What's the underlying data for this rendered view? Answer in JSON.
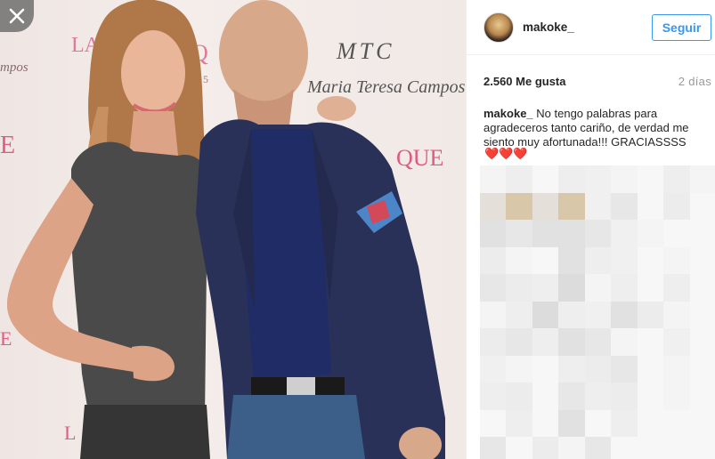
{
  "post": {
    "username": "makoke_",
    "follow_label": "Seguir",
    "likes": "2.560 Me gusta",
    "time_ago": "2 días",
    "caption_user": "makoke_",
    "caption_text": " No tengo palabras para agradeceros tanto cariño, de verdad me siento muy afortunada!!! GRACIASSSS",
    "caption_emoji": "❤️❤️❤️"
  },
  "photo": {
    "backdrop_texts": {
      "mtc": "MTC",
      "script": "Maria Teresa Campos",
      "brand_left": "LA",
      "brand_q": "QUE",
      "partial_1": "Q",
      "partial_2": "5",
      "side_text": "mpos"
    },
    "colors": {
      "backdrop": "#f1e9e6",
      "brand_pink": "#e05a83",
      "jacket": "#2a3158",
      "shirt": "#1f2c66",
      "jeans": "#3c5f8a",
      "top_gray": "#4a4a4a"
    }
  },
  "ui": {
    "close_icon": "close-icon",
    "accent": "#3897f0"
  },
  "blur_palette": [
    "#f4f4f4",
    "#eeeeee",
    "#e7e7e7",
    "#e1e1e1",
    "#f7f7f7",
    "#ececec",
    "#dcdcdc",
    "#f0f0f0",
    "#e4dfd8",
    "#d9c7aa"
  ]
}
